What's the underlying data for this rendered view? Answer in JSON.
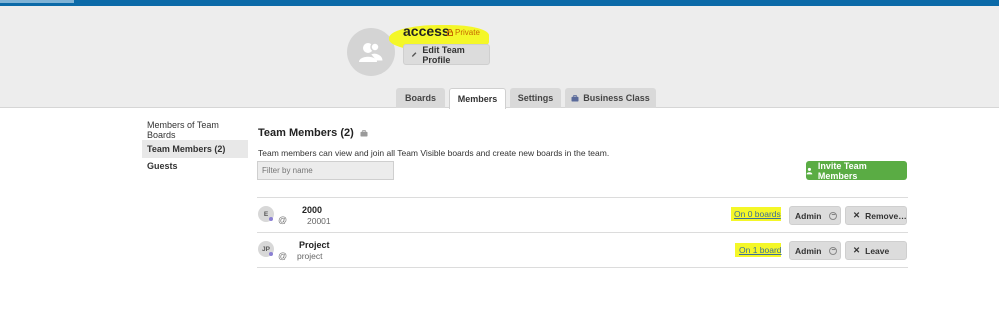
{
  "team": {
    "name": "access",
    "privacy": "Private",
    "edit_label": "Edit Team Profile",
    "avatar_icon": "team-people-icon"
  },
  "tabs": [
    {
      "label": "Boards",
      "active": false
    },
    {
      "label": "Members",
      "active": true
    },
    {
      "label": "Settings",
      "active": false
    },
    {
      "label": "Business Class",
      "active": false,
      "icon": "briefcase-icon"
    }
  ],
  "sidebar": {
    "items": [
      {
        "label": "Members of Team Boards"
      },
      {
        "label": "Team Members (2)",
        "selected": true
      },
      {
        "label": "Guests"
      }
    ]
  },
  "main": {
    "title": "Team Members (2)",
    "description": "Team members can view and join all Team Visible boards and create new boards in the team.",
    "filter_placeholder": "Filter by name",
    "invite_label": "Invite Team Members"
  },
  "members": [
    {
      "initials": "E",
      "name": "2000",
      "username": "20001",
      "at": "@",
      "boards": "On 0 boards",
      "role": "Admin",
      "action": "Remove…"
    },
    {
      "initials": "JP",
      "name": "Project",
      "username": "project",
      "at": "@",
      "boards": "On 1 board",
      "role": "Admin",
      "action": "Leave"
    }
  ],
  "colors": {
    "accent": "#0b6aa8",
    "invite": "#5aac44",
    "highlight": "#f4f728",
    "private": "#c76a00"
  }
}
